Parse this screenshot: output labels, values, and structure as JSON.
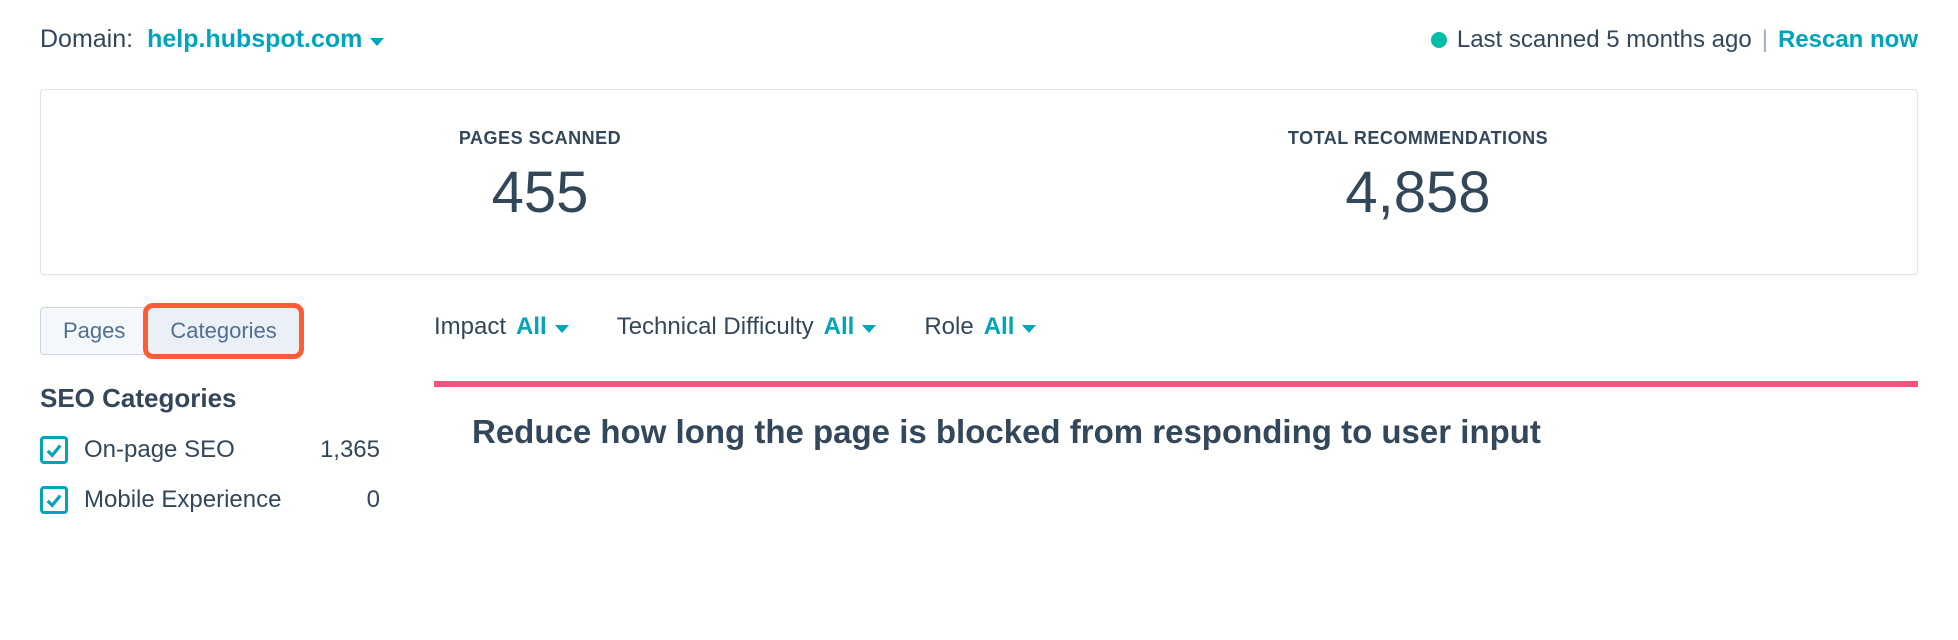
{
  "header": {
    "domain_label": "Domain:",
    "domain_value": "help.hubspot.com",
    "scan_status": "Last scanned 5 months ago",
    "rescan_label": "Rescan now"
  },
  "stats": [
    {
      "label": "PAGES SCANNED",
      "value": "455"
    },
    {
      "label": "TOTAL RECOMMENDATIONS",
      "value": "4,858"
    }
  ],
  "tabs": {
    "pages": "Pages",
    "categories": "Categories"
  },
  "sidebar": {
    "title": "SEO Categories",
    "items": [
      {
        "label": "On-page SEO",
        "count": "1,365"
      },
      {
        "label": "Mobile Experience",
        "count": "0"
      }
    ]
  },
  "filters": {
    "impact_label": "Impact",
    "impact_value": "All",
    "difficulty_label": "Technical Difficulty",
    "difficulty_value": "All",
    "role_label": "Role",
    "role_value": "All"
  },
  "recommendation": {
    "title": "Reduce how long the page is blocked from responding to user input"
  },
  "colors": {
    "accent": "#00a4bd",
    "status_green": "#00bda5",
    "highlight": "#ff5c35",
    "card_top": "#f2547d"
  }
}
